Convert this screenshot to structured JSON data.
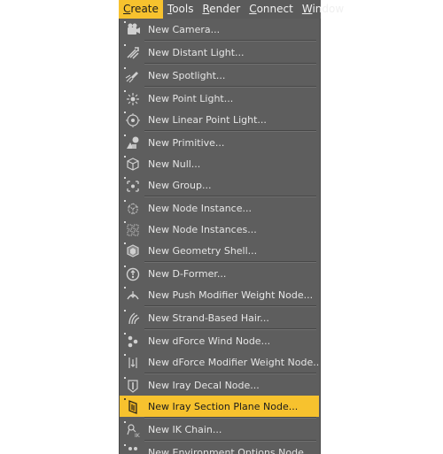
{
  "menubar": {
    "items": [
      {
        "label": "Create",
        "underline": "C",
        "rest": "reate",
        "active": true
      },
      {
        "label": "Tools",
        "underline": "T",
        "rest": "ools",
        "active": false
      },
      {
        "label": "Render",
        "underline": "R",
        "rest": "ender",
        "active": false
      },
      {
        "label": "Connect",
        "underline": "C",
        "rest": "onnect",
        "active": false
      },
      {
        "label": "Window",
        "underline": "W",
        "rest": "indow",
        "active": false
      }
    ]
  },
  "menu": {
    "items": [
      {
        "label": "New Camera...",
        "icon": "camera-icon"
      },
      {
        "label": "New Distant Light...",
        "icon": "distant-light-icon"
      },
      {
        "label": "New Spotlight...",
        "icon": "spotlight-icon"
      },
      {
        "label": "New Point Light...",
        "icon": "point-light-icon"
      },
      {
        "label": "New Linear Point Light...",
        "icon": "linear-point-light-icon"
      },
      {
        "label": "New Primitive...",
        "icon": "primitive-icon"
      },
      {
        "label": "New Null...",
        "icon": "null-icon"
      },
      {
        "label": "New Group...",
        "icon": "group-icon"
      },
      {
        "label": "New Node Instance...",
        "icon": "node-instance-icon"
      },
      {
        "label": "New Node Instances...",
        "icon": "node-instances-icon"
      },
      {
        "label": "New Geometry Shell...",
        "icon": "geometry-shell-icon"
      },
      {
        "label": "New D-Former...",
        "icon": "d-former-icon"
      },
      {
        "label": "New Push Modifier Weight Node...",
        "icon": "push-modifier-icon"
      },
      {
        "label": "New Strand-Based Hair...",
        "icon": "strand-hair-icon"
      },
      {
        "label": "New dForce Wind Node...",
        "icon": "dforce-wind-icon"
      },
      {
        "label": "New dForce Modifier Weight Node...",
        "icon": "dforce-modifier-icon"
      },
      {
        "label": "New Iray Decal Node...",
        "icon": "iray-decal-icon"
      },
      {
        "label": "New Iray Section Plane Node...",
        "icon": "iray-section-plane-icon",
        "highlighted": true
      },
      {
        "label": "New IK Chain...",
        "icon": "ik-chain-icon"
      },
      {
        "label": "New Environment Options Node...",
        "icon": "environment-options-icon"
      }
    ]
  },
  "colors": {
    "accent": "#f7c22e",
    "menu_bg": "#5e5e5e",
    "text": "#e6e6e6"
  }
}
